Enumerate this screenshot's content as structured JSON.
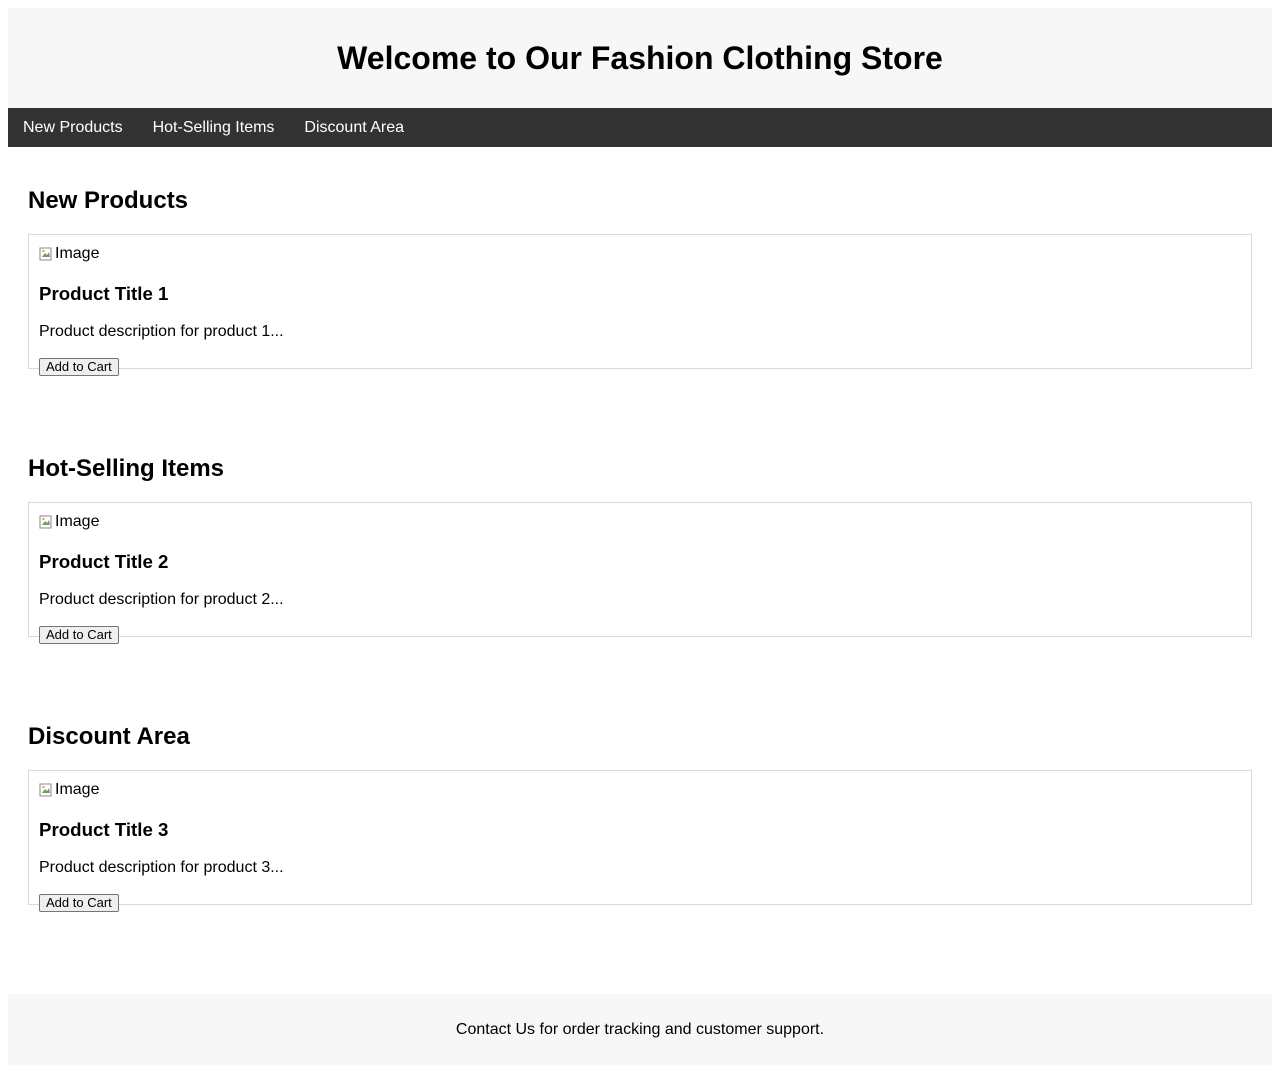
{
  "header": {
    "title": "Welcome to Our Fashion Clothing Store"
  },
  "nav": {
    "items": [
      {
        "label": "New Products"
      },
      {
        "label": "Hot-Selling Items"
      },
      {
        "label": "Discount Area"
      }
    ]
  },
  "sections": [
    {
      "heading": "New Products",
      "product": {
        "image_alt": "Image",
        "title": "Product Title 1",
        "description": "Product description for product 1...",
        "button_label": "Add to Cart"
      }
    },
    {
      "heading": "Hot-Selling Items",
      "product": {
        "image_alt": "Image",
        "title": "Product Title 2",
        "description": "Product description for product 2...",
        "button_label": "Add to Cart"
      }
    },
    {
      "heading": "Discount Area",
      "product": {
        "image_alt": "Image",
        "title": "Product Title 3",
        "description": "Product description for product 3...",
        "button_label": "Add to Cart"
      }
    }
  ],
  "footer": {
    "text": "Contact Us for order tracking and customer support."
  },
  "colors": {
    "header_bg": "#f7f7f7",
    "nav_bg": "#333333",
    "nav_text": "#ffffff",
    "card_border": "#d9d9d9"
  }
}
